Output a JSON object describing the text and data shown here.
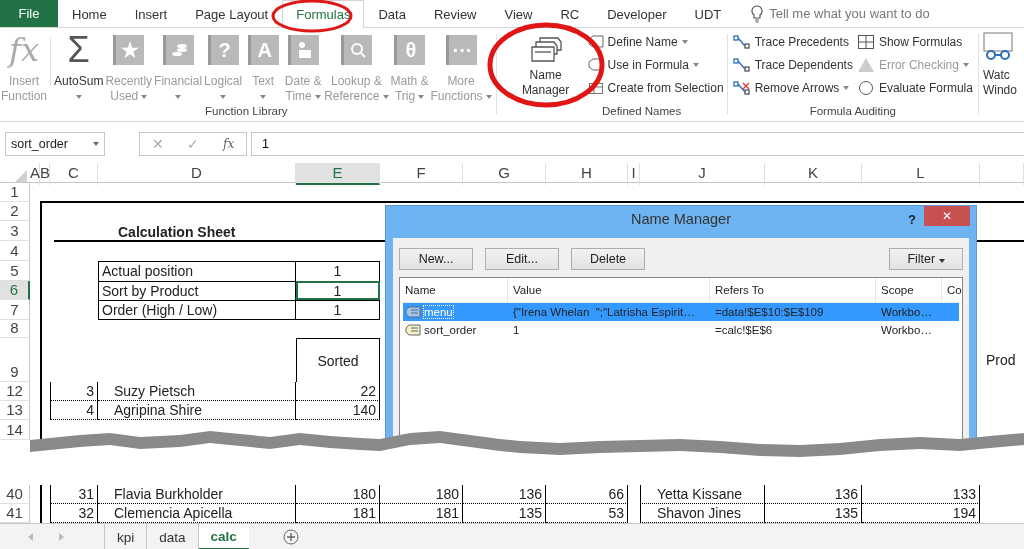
{
  "ribbon_tabs": [
    {
      "label": "File",
      "kind": "file",
      "selected": false
    },
    {
      "label": "Home",
      "kind": "tab",
      "selected": false
    },
    {
      "label": "Insert",
      "kind": "tab",
      "selected": false
    },
    {
      "label": "Page Layout",
      "kind": "tab",
      "selected": false
    },
    {
      "label": "Formulas",
      "kind": "tab",
      "selected": true
    },
    {
      "label": "Data",
      "kind": "tab",
      "selected": false
    },
    {
      "label": "Review",
      "kind": "tab",
      "selected": false
    },
    {
      "label": "View",
      "kind": "tab",
      "selected": false
    },
    {
      "label": "RC",
      "kind": "tab",
      "selected": false
    },
    {
      "label": "Developer",
      "kind": "tab",
      "selected": false
    },
    {
      "label": "UDT",
      "kind": "tab",
      "selected": false
    }
  ],
  "tell_me": {
    "placeholder": "Tell me what you want to do"
  },
  "function_library": {
    "title": "Function Library",
    "buttons": [
      {
        "lines": [
          "Insert",
          "Function"
        ],
        "glyph": "fx",
        "disabled": true,
        "dropdown": false
      },
      {
        "lines": [
          "AutoSum"
        ],
        "glyph": "Σ",
        "disabled": false,
        "dropdown": true
      },
      {
        "lines": [
          "Recently",
          "Used"
        ],
        "glyph": "★",
        "disabled": true,
        "dropdown": true
      },
      {
        "lines": [
          "Financial"
        ],
        "disabled": true,
        "dropdown": true
      },
      {
        "lines": [
          "Logical"
        ],
        "glyph": "?",
        "disabled": true,
        "dropdown": true
      },
      {
        "lines": [
          "Text"
        ],
        "glyph": "A",
        "disabled": true,
        "dropdown": true
      },
      {
        "lines": [
          "Date &",
          "Time"
        ],
        "disabled": true,
        "dropdown": true
      },
      {
        "lines": [
          "Lookup &",
          "Reference"
        ],
        "disabled": true,
        "dropdown": true
      },
      {
        "lines": [
          "Math &",
          "Trig"
        ],
        "glyph": "θ",
        "disabled": true,
        "dropdown": true
      },
      {
        "lines": [
          "More",
          "Functions"
        ],
        "glyph": "···",
        "disabled": true,
        "dropdown": true
      }
    ]
  },
  "defined_names": {
    "title": "Defined Names",
    "manager": {
      "lines": [
        "Name",
        "Manager"
      ]
    },
    "items": [
      {
        "label": "Define Name",
        "dropdown": true
      },
      {
        "label": "Use in Formula",
        "dropdown": true
      },
      {
        "label": "Create from Selection",
        "dropdown": false
      }
    ]
  },
  "formula_auditing": {
    "title": "Formula Auditing",
    "items": [
      {
        "label": "Trace Precedents",
        "disabled": false,
        "dropdown": false
      },
      {
        "label": "Trace Dependents",
        "disabled": false,
        "dropdown": false
      },
      {
        "label": "Remove Arrows",
        "disabled": false,
        "dropdown": true
      },
      {
        "label": "Show Formulas",
        "disabled": false,
        "dropdown": false
      },
      {
        "label": "Error Checking",
        "disabled": true,
        "dropdown": true
      },
      {
        "label": "Evaluate Formula",
        "disabled": false,
        "dropdown": false
      }
    ]
  },
  "watch_window": {
    "lines": [
      "Watc",
      "Windo"
    ]
  },
  "formula_bar": {
    "name_box": "sort_order",
    "buttons": [
      "✕",
      "✓",
      "fx"
    ],
    "value": "1"
  },
  "sheet": {
    "columns": [
      {
        "label": "A",
        "selected": false
      },
      {
        "label": "B",
        "selected": false
      },
      {
        "label": "C",
        "selected": false
      },
      {
        "label": "D",
        "selected": false
      },
      {
        "label": "E",
        "selected": true
      },
      {
        "label": "F",
        "selected": false
      },
      {
        "label": "G",
        "selected": false
      },
      {
        "label": "H",
        "selected": false
      },
      {
        "label": "I",
        "selected": false
      },
      {
        "label": "J",
        "selected": false
      },
      {
        "label": "K",
        "selected": false
      },
      {
        "label": "L",
        "selected": false
      }
    ],
    "top_rows": [
      {
        "header": "1",
        "selected": false,
        "kind": "blank"
      },
      {
        "header": "2",
        "selected": false,
        "kind": "blank"
      },
      {
        "header": "3",
        "selected": false,
        "kind": "title",
        "title": "Calculation Sheet"
      },
      {
        "header": "4",
        "selected": false,
        "kind": "blank"
      },
      {
        "header": "5",
        "selected": false,
        "kind": "setting",
        "label": "Actual position",
        "value": "1"
      },
      {
        "header": "6",
        "selected": true,
        "kind": "setting",
        "label": "Sort by Product",
        "value": "1"
      },
      {
        "header": "7",
        "selected": false,
        "kind": "setting",
        "label": "Order (High / Low)",
        "value": "1"
      },
      {
        "header": "8",
        "selected": false,
        "kind": "blank"
      },
      {
        "header": "9",
        "selected": false,
        "kind": "heading",
        "heading": "Sorted",
        "column_13": "Prod"
      },
      {
        "header": "12",
        "selected": false,
        "kind": "entry",
        "index": "3",
        "name": "Suzy Pietsch",
        "values": [
          "22"
        ]
      },
      {
        "header": "13",
        "selected": false,
        "kind": "entry",
        "index": "4",
        "name": "Agripina Shire",
        "values": [
          "140"
        ]
      },
      {
        "header": "14",
        "selected": false,
        "kind": "blank"
      }
    ],
    "bottom_rows": [
      {
        "header": "40",
        "selected": false,
        "kind": "entry",
        "index": "31",
        "name": "Flavia Burkholder",
        "values": [
          "180",
          "180",
          "136",
          "66"
        ],
        "name_2": "Yetta Kissane",
        "values_2": [
          "136",
          "133"
        ]
      },
      {
        "header": "41",
        "selected": false,
        "kind": "entry",
        "index": "32",
        "name": "Clemencia Apicella",
        "values": [
          "181",
          "181",
          "135",
          "53"
        ],
        "name_2": "Shavon Jines",
        "values_2": [
          "135",
          "194"
        ]
      }
    ]
  },
  "dialog": {
    "title": "Name Manager",
    "help": "?",
    "close": "✕",
    "buttons": [
      "New...",
      "Edit...",
      "Delete"
    ],
    "filter": "Filter",
    "columns": [
      "Name",
      "Value",
      "Refers To",
      "Scope",
      "Co"
    ],
    "rows": [
      {
        "name": "menu",
        "value": "{\"Irena Whelan  \";\"Latrisha Espirit…",
        "refers_to": "=data!$E$10:$E$109",
        "scope": "Workbo…",
        "selected": true
      },
      {
        "name": "sort_order",
        "value": "1",
        "refers_to": "=calc!$E$6",
        "scope": "Workbo…",
        "selected": false
      }
    ]
  },
  "sheet_tabs": [
    {
      "label": "kpi",
      "selected": false
    },
    {
      "label": "data",
      "selected": false
    },
    {
      "label": "calc",
      "selected": true
    }
  ]
}
